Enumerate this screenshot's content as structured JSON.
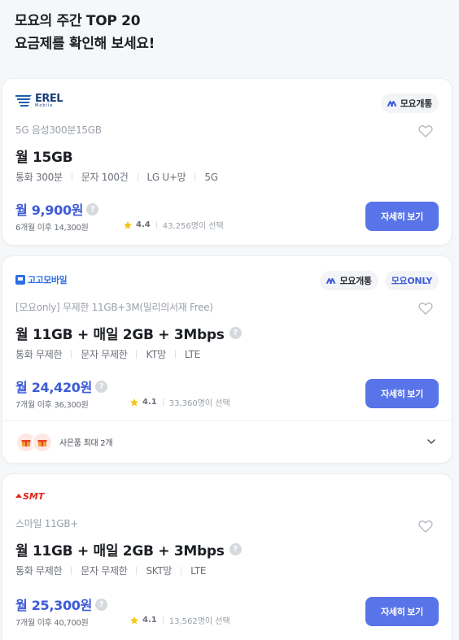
{
  "header": {
    "line1": "모요의 주간 TOP 20",
    "line2": "요금제를 확인해 보세요!"
  },
  "brand_color": "#3d5bd8",
  "button_color": "#5874e8",
  "cards": [
    {
      "carrier_logo": "EREL",
      "carrier_logo_sub": "Mobile",
      "badges": [
        "모요개통"
      ],
      "subtitle": "5G 음성300분15GB",
      "plan_name": "월 15GB",
      "specs": [
        "통화 300분",
        "문자 100건",
        "LG U+망",
        "5G"
      ],
      "price": "월 9,900원",
      "after_price": "6개월 이후 14,300원",
      "rating": "4.4",
      "selected_count": "43,256명이 선택",
      "detail_label": "자세히 보기"
    },
    {
      "carrier_logo": "고고모바일",
      "badges": [
        "모요개통",
        "모요ONLY"
      ],
      "subtitle": "[모요only] 무제한 11GB+3M(밀리의서재 Free)",
      "plan_name": "월 11GB + 매일 2GB + 3Mbps",
      "specs": [
        "통화 무제한",
        "문자 무제한",
        "KT망",
        "LTE"
      ],
      "price": "월 24,420원",
      "after_price": "7개월 이후 36,300원",
      "rating": "4.1",
      "selected_count": "33,360명이 선택",
      "detail_label": "자세히 보기",
      "gift_text": "사은품 최대 2개"
    },
    {
      "carrier_logo": "SMT",
      "badges": [],
      "subtitle": "스마일 11GB+",
      "plan_name": "월 11GB + 매일 2GB + 3Mbps",
      "specs": [
        "통화 무제한",
        "문자 무제한",
        "SKT망",
        "LTE"
      ],
      "price": "월 25,300원",
      "after_price": "7개월 이후 40,700원",
      "rating": "4.1",
      "selected_count": "13,562명이 선택",
      "detail_label": "자세히 보기"
    }
  ],
  "icons": {
    "heart": "heart-icon",
    "help": "help-icon",
    "star": "star-icon",
    "gift": "gift-icon",
    "chevron": "chevron-down-icon",
    "moyo": "moyo-logo-icon"
  }
}
